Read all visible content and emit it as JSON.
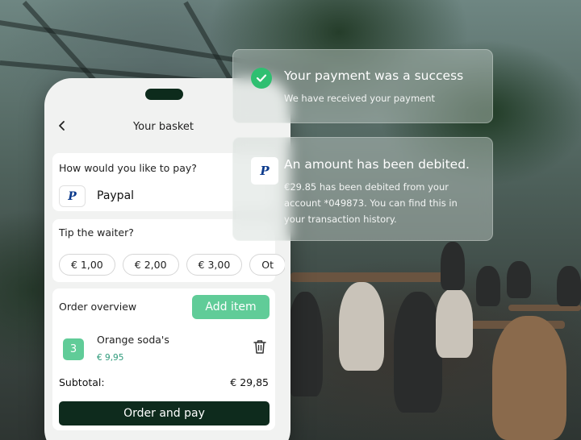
{
  "header": {
    "title": "Your basket"
  },
  "payment": {
    "question": "How would you like to pay?",
    "method": "Paypal",
    "method_logo": "P"
  },
  "tip": {
    "question": "Tip the waiter?",
    "options": [
      "€ 1,00",
      "€ 2,00",
      "€ 3,00",
      "Ot"
    ]
  },
  "order": {
    "heading": "Order overview",
    "add_label": "Add item",
    "items": [
      {
        "qty": "3",
        "name": "Orange soda's",
        "price": "€ 9,95"
      }
    ],
    "subtotal_label": "Subtotal:",
    "subtotal_value": "€ 29,85",
    "order_label": "Order and pay"
  },
  "notifications": [
    {
      "icon": "check-circle-icon",
      "title": "Your payment was a success",
      "body": "We have received your payment"
    },
    {
      "icon": "paypal-icon",
      "title": "An amount has been debited.",
      "body_lines": [
        "€29.85 has been debited from your",
        "account *049873. You can find this in",
        "your transaction history."
      ]
    }
  ],
  "colors": {
    "accent": "#60cc98",
    "primary_dark": "#0e2b1d",
    "success": "#2fbf71",
    "price": "#2d9a7a"
  }
}
